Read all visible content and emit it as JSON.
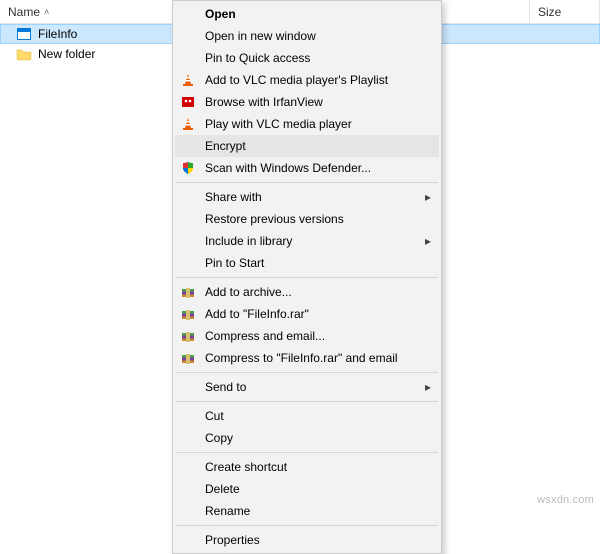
{
  "columns": {
    "name": "Name",
    "size": "Size"
  },
  "files": [
    {
      "name": "FileInfo"
    },
    {
      "name": "New folder"
    }
  ],
  "context_menu": {
    "open": "Open",
    "open_new_window": "Open in new window",
    "pin_quick_access": "Pin to Quick access",
    "add_vlc_playlist": "Add to VLC media player's Playlist",
    "browse_irfanview": "Browse with IrfanView",
    "play_vlc": "Play with VLC media player",
    "encrypt": "Encrypt",
    "scan_defender": "Scan with Windows Defender...",
    "share_with": "Share with",
    "restore_previous": "Restore previous versions",
    "include_library": "Include in library",
    "pin_start": "Pin to Start",
    "add_archive": "Add to archive...",
    "add_rar": "Add to \"FileInfo.rar\"",
    "compress_email": "Compress and email...",
    "compress_rar_email": "Compress to \"FileInfo.rar\" and email",
    "send_to": "Send to",
    "cut": "Cut",
    "copy": "Copy",
    "create_shortcut": "Create shortcut",
    "delete": "Delete",
    "rename": "Rename",
    "properties": "Properties"
  },
  "watermark": "wsxdn.com"
}
